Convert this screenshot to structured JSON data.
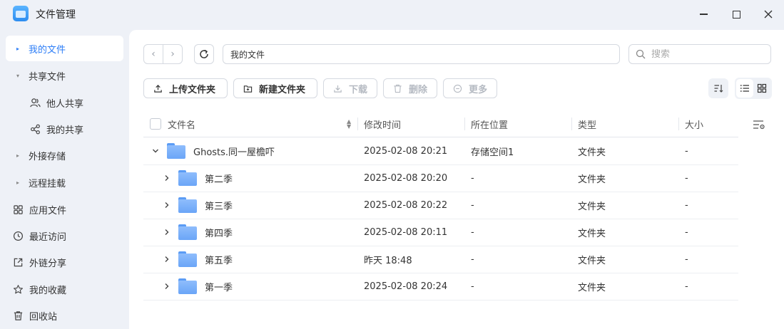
{
  "window": {
    "title": "文件管理",
    "controls": {
      "minimize": "minimize-icon",
      "maximize": "maximize-icon",
      "close": "close-icon"
    }
  },
  "sidebar": {
    "items": [
      {
        "label": "我的文件",
        "kind": "caret",
        "active": true
      },
      {
        "label": "共享文件",
        "kind": "caret-open"
      },
      {
        "label": "他人共享",
        "kind": "sub",
        "icon": "users-icon"
      },
      {
        "label": "我的共享",
        "kind": "sub",
        "icon": "share-icon"
      },
      {
        "label": "外接存储",
        "kind": "caret"
      },
      {
        "label": "远程挂载",
        "kind": "caret"
      },
      {
        "label": "应用文件",
        "icon": "apps-icon"
      },
      {
        "label": "最近访问",
        "icon": "clock-icon"
      },
      {
        "label": "外链分享",
        "icon": "external-link-icon"
      },
      {
        "label": "我的收藏",
        "icon": "star-icon"
      },
      {
        "label": "回收站",
        "icon": "trash-icon"
      }
    ]
  },
  "navigation": {
    "path": "我的文件",
    "search_placeholder": "搜索"
  },
  "toolbar": {
    "upload_folder": "上传文件夹",
    "new_folder": "新建文件夹",
    "download": "下载",
    "delete": "删除",
    "more": "更多"
  },
  "table": {
    "columns": [
      "文件名",
      "修改时间",
      "所在位置",
      "类型",
      "大小"
    ],
    "rows": [
      {
        "name": "Ghosts.同一屋檐吓",
        "modified": "2025-02-08 20:21",
        "location": "存储空间1",
        "type": "文件夹",
        "size": "-",
        "expanded": true,
        "level": 0
      },
      {
        "name": "第二季",
        "modified": "2025-02-08 20:20",
        "location": "-",
        "type": "文件夹",
        "size": "-",
        "expanded": false,
        "level": 1
      },
      {
        "name": "第三季",
        "modified": "2025-02-08 20:22",
        "location": "-",
        "type": "文件夹",
        "size": "-",
        "expanded": false,
        "level": 1
      },
      {
        "name": "第四季",
        "modified": "2025-02-08 20:11",
        "location": "-",
        "type": "文件夹",
        "size": "-",
        "expanded": false,
        "level": 1
      },
      {
        "name": "第五季",
        "modified": "昨天 18:48",
        "location": "-",
        "type": "文件夹",
        "size": "-",
        "expanded": false,
        "level": 1
      },
      {
        "name": "第一季",
        "modified": "2025-02-08 20:24",
        "location": "-",
        "type": "文件夹",
        "size": "-",
        "expanded": false,
        "level": 1
      }
    ]
  },
  "colors": {
    "accent": "#2d7ef7",
    "sidebar_bg": "#eef1f7",
    "folder": "#6aa5f7"
  }
}
